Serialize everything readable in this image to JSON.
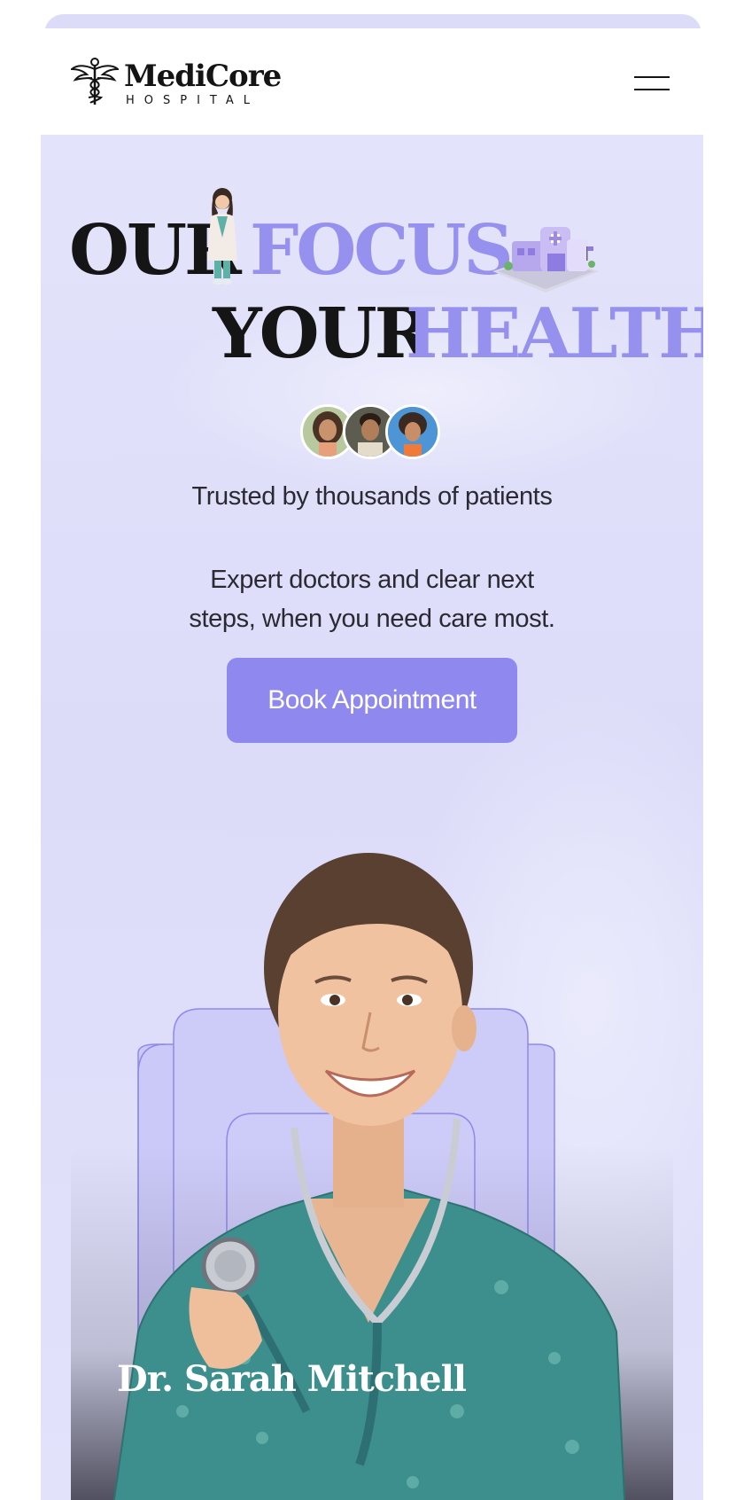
{
  "brand": {
    "name": "MediCore",
    "subtitle": "HOSPITAL"
  },
  "header": {
    "menu_icon": "hamburger-menu-icon"
  },
  "hero": {
    "headline": {
      "line1_dark": "OUR",
      "line1_accent": "FOCUS",
      "line2_dark": "YOUR",
      "line2_accent": "HEALTH"
    },
    "trust_text": "Trusted by thousands of patients",
    "description_line1": "Expert doctors and clear next",
    "description_line2": "steps, when you need care most.",
    "cta_label": "Book Appointment"
  },
  "doctor_card": {
    "name": "Dr. Sarah Mitchell"
  },
  "colors": {
    "accent": "#9690ee",
    "button": "#8f88ee",
    "background": "#dfdffa",
    "text_dark": "#151515",
    "scrubs": "#3c8f8c"
  },
  "icons": [
    "caduceus-logo-icon",
    "hamburger-menu-icon",
    "doctor-figurine-icon",
    "hospital-building-icon"
  ]
}
